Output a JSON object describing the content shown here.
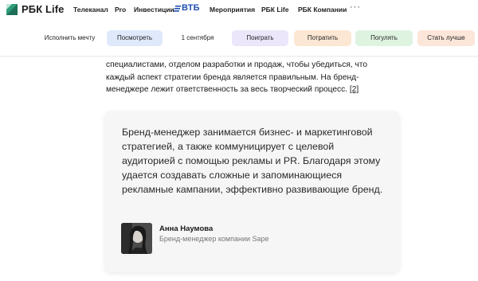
{
  "nav": {
    "logo": "РБК Life",
    "items": [
      "Телеканал",
      "Pro",
      "Инвестиции",
      "Мероприятия",
      "РБК Life",
      "РБК Компании"
    ],
    "partner": "ВТБ",
    "more": "···"
  },
  "chips": [
    {
      "label": "Исполнить мечту",
      "color": "#ffffff"
    },
    {
      "label": "Посмотреть",
      "color": "#dfe9fb"
    },
    {
      "label": "1 сентября",
      "color": "#ffffff"
    },
    {
      "label": "Поиграть",
      "color": "#ece6fb"
    },
    {
      "label": "Потратить",
      "color": "#fbe7d3"
    },
    {
      "label": "Погулять",
      "color": "#dff3e1"
    },
    {
      "label": "Стать лучше",
      "color": "#fbe6d9"
    }
  ],
  "article": {
    "line1": "специалистами, отделом разработки и продаж, чтобы убедиться, что",
    "line2": "каждый аспект стратегии бренда является правильным. На бренд-",
    "line3": "менеджере лежит ответственность за весь творческий процесс.",
    "ref": "[2]"
  },
  "quote": {
    "text": "Бренд-менеджер занимается бизнес- и маркетинговой стратегией, а также коммуницирует с целевой аудиторией с помощью рекламы и PR. Благодаря этому удается создавать сложные и запоминающиеся рекламные кампании, эффективно развивающие бренд.",
    "author_name": "Анна Наумова",
    "author_role": "Бренд-менеджер компании Sape"
  }
}
